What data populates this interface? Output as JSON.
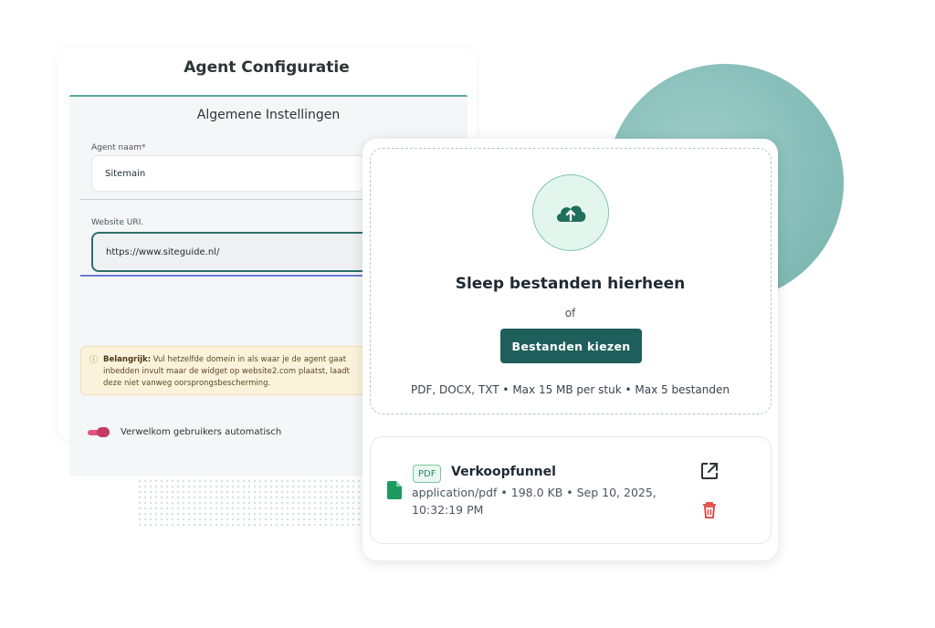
{
  "config": {
    "title": "Agent Configuratie",
    "section_title": "Algemene Instellingen",
    "agent_name": {
      "label": "Agent naam*",
      "value": "Sitemain"
    },
    "website_uri": {
      "label": "Website URI.",
      "value": "https://www.siteguide.nl/"
    },
    "notice": {
      "strong": "Belangrijk:",
      "text": " Vul hetzelfde domein in als waar je de agent gaat inbedden invult maar de widget op website2.com plaatst, laadt deze niet vanweg oorsprongsbescherming."
    },
    "welcome_toggle": {
      "label": "Verwelkom gebruikers automatisch",
      "on": true
    }
  },
  "upload": {
    "title": "Sleep bestanden hierheen",
    "or": "of",
    "button": "Bestanden kiezen",
    "hint": "PDF, DOCX, TXT • Max 15 MB per stuk • Max 5 bestanden"
  },
  "file": {
    "badge": "PDF",
    "name": "Verkoopfunnel",
    "meta": "application/pdf • 198.0 KB • Sep 10, 2025, 10:32:19 PM"
  },
  "icons": {
    "upload": "cloud-upload-icon",
    "file": "file-icon",
    "open": "open-external-icon",
    "delete": "trash-icon",
    "notice": "info-icon"
  },
  "colors": {
    "accent": "#1f5f5b",
    "success": "#2e8a63",
    "danger": "#e0403a",
    "toggle": "#e0557d",
    "warning_bg": "#fbf2dc"
  }
}
